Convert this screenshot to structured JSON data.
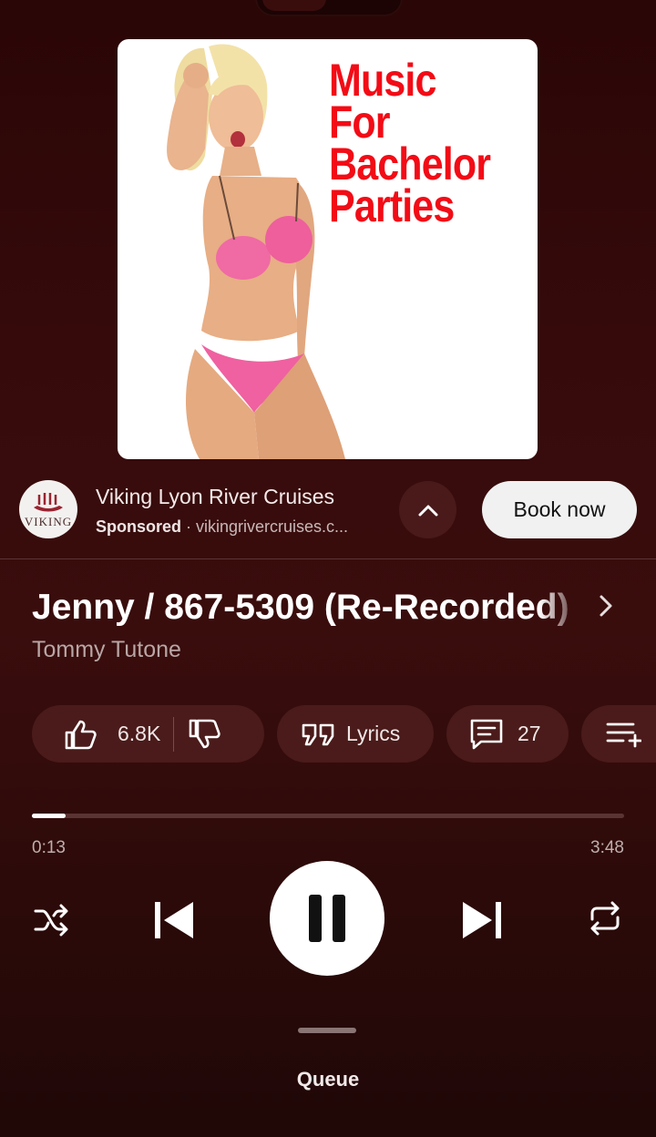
{
  "album": {
    "title_lines": [
      "Music",
      "For",
      "Bachelor",
      "Parties"
    ],
    "title_color": "#f20c16"
  },
  "ad": {
    "logo_text": "VIKING",
    "title": "Viking Lyon River Cruises",
    "sponsored_label": "Sponsored",
    "separator": " · ",
    "domain": "vikingrivercruises.c...",
    "cta": "Book now"
  },
  "song": {
    "title": "Jenny / 867-5309 (Re-Recorded)",
    "artist": "Tommy Tutone"
  },
  "actions": {
    "like_count": "6.8K",
    "lyrics_label": "Lyrics",
    "comment_count": "27"
  },
  "player": {
    "current_time": "0:13",
    "total_time": "3:48",
    "progress_fraction": 0.057
  },
  "queue_label": "Queue",
  "icons": [
    "thumbs-up-icon",
    "thumbs-down-icon",
    "lyrics-quote-icon",
    "comment-icon",
    "add-to-queue-icon",
    "shuffle-icon",
    "previous-icon",
    "pause-icon",
    "next-icon",
    "repeat-icon",
    "chevron-up-icon",
    "chevron-right-icon"
  ],
  "colors": {
    "background": "#360a0b",
    "chip": "#4a1b1a",
    "accent_white": "#ffffff"
  }
}
